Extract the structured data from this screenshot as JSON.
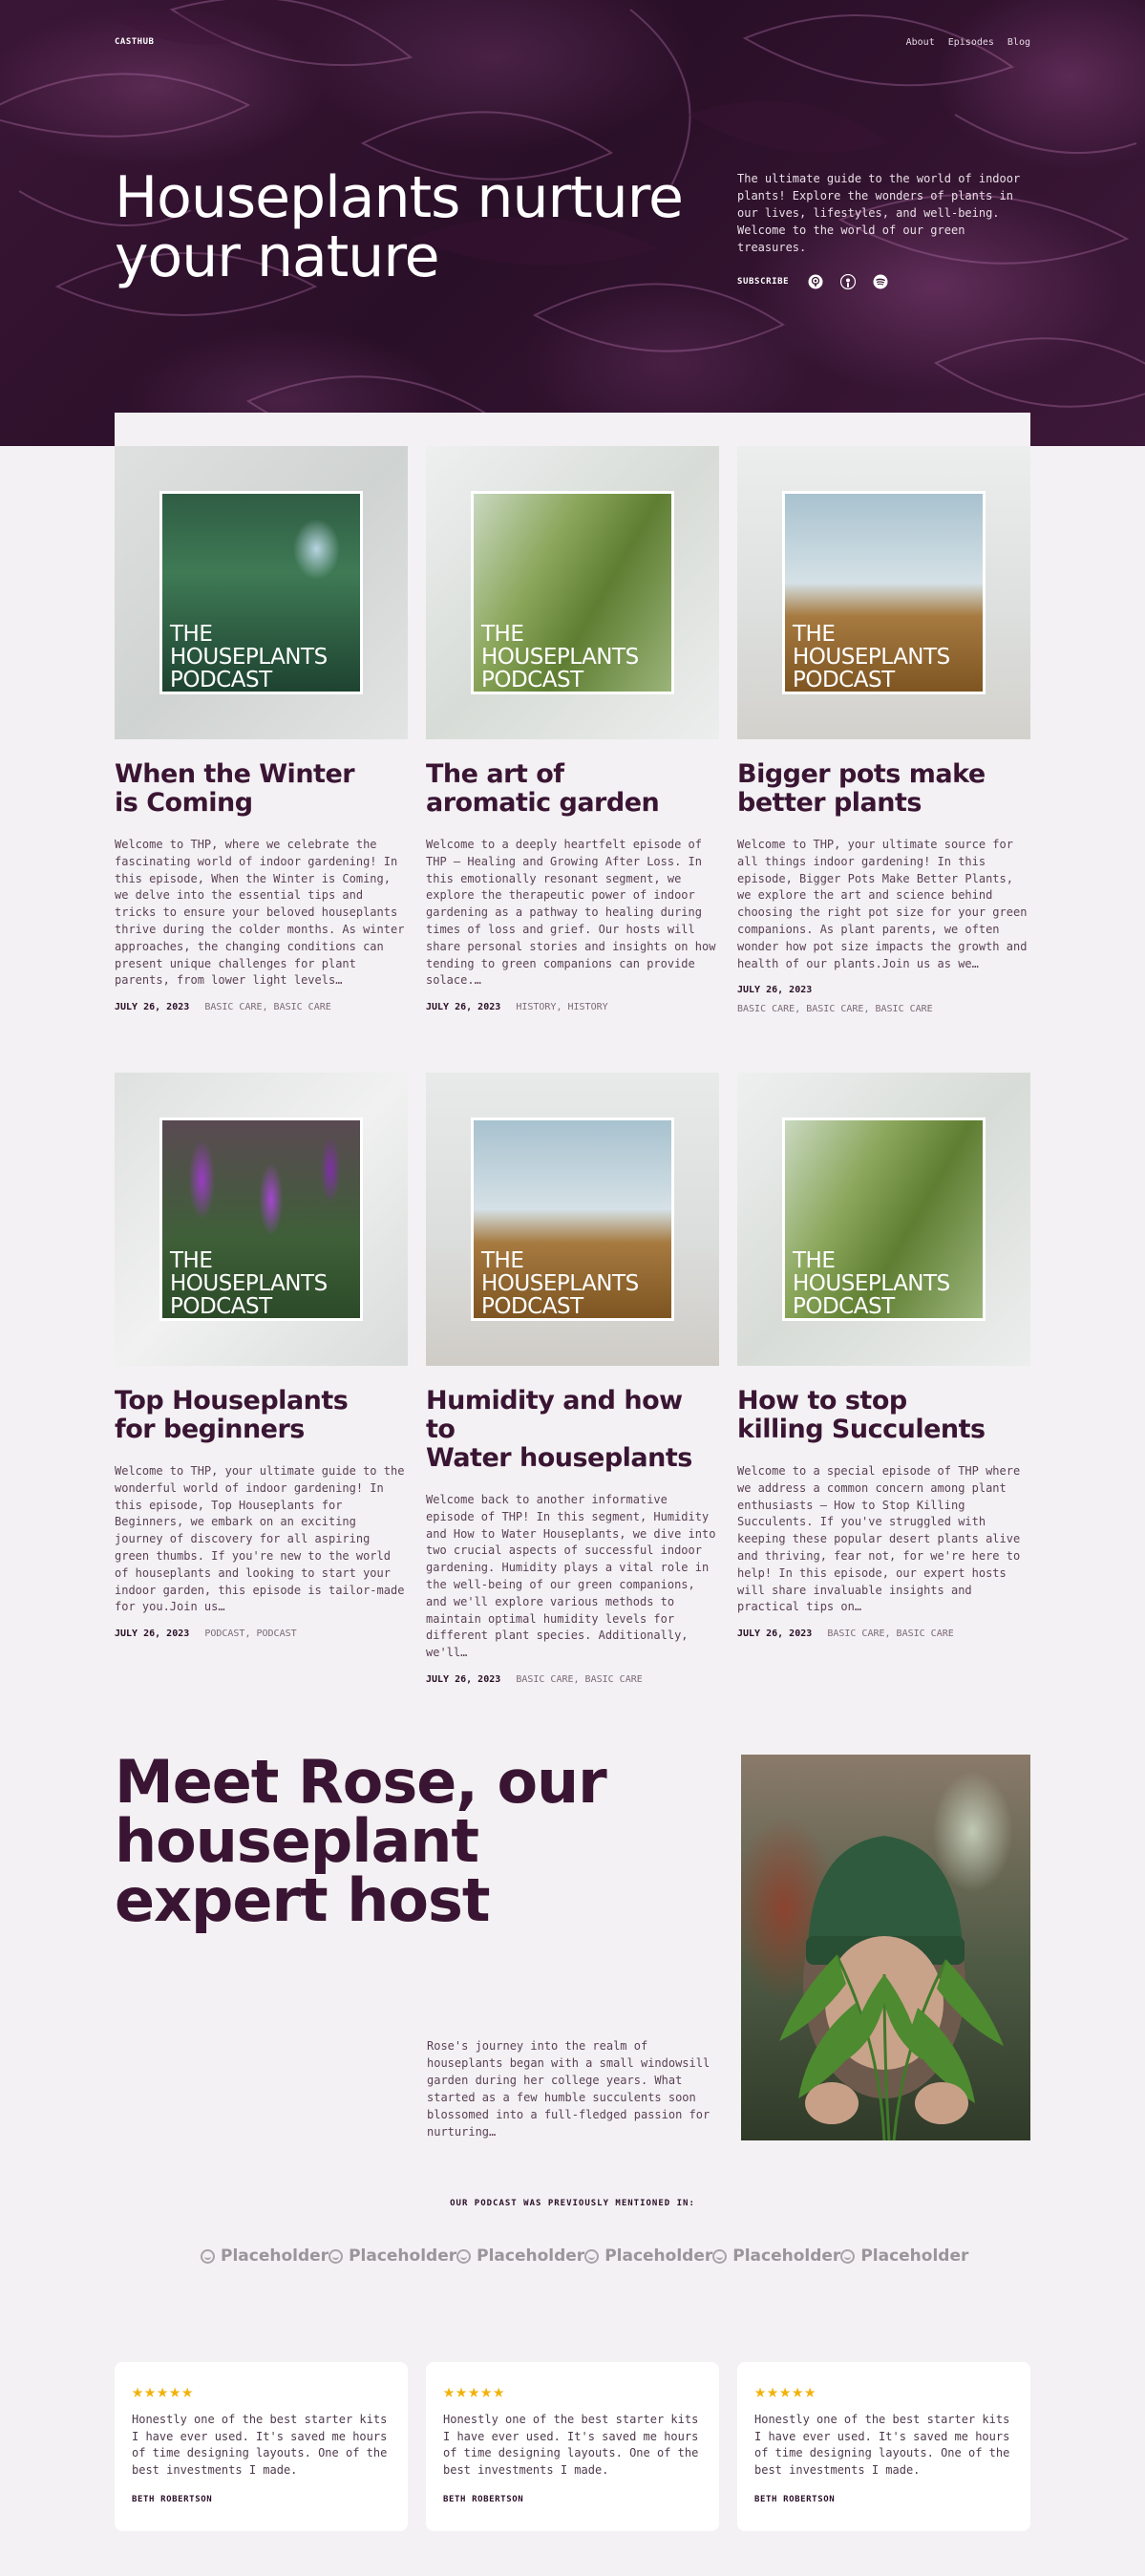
{
  "header": {
    "brand": "CASTHUB",
    "nav": [
      "About",
      "Episodes",
      "Blog"
    ]
  },
  "hero": {
    "title": "Houseplants nurture your nature",
    "description": "The ultimate guide to the world of indoor plants! Explore the wonders of plants in our lives, lifestyles, and well-being. Welcome to the world of our green treasures.",
    "subscribe_label": "SUBSCRIBE",
    "subscribe_icons": [
      "apple-podcasts-icon",
      "podcast-icon",
      "spotify-icon"
    ]
  },
  "cover_text": "THE\nHOUSEPLANTS\nPODCAST",
  "episodes": [
    {
      "title": "When the Winter\nis Coming",
      "description": "Welcome to THP, where we celebrate the fascinating world of indoor gardening! In this episode, When the Winter is Coming, we delve into the essential tips and tricks to ensure your beloved houseplants thrive during the colder months. As winter approaches, the changing conditions can present unique challenges for plant parents, from lower light levels…",
      "date": "JULY 26, 2023",
      "tags": "BASIC CARE, BASIC CARE"
    },
    {
      "title": "The art of\naromatic garden",
      "description": "Welcome to a deeply heartfelt episode of THP – Healing and Growing After Loss. In this emotionally resonant segment, we explore the therapeutic power of indoor gardening as a pathway to healing during times of loss and grief. Our hosts will share personal stories and insights on how tending to green companions can provide solace.…",
      "date": "JULY 26, 2023",
      "tags": "HISTORY, HISTORY"
    },
    {
      "title": "Bigger pots make\nbetter plants",
      "description": "Welcome to THP, your ultimate source for all things indoor gardening! In this episode, Bigger Pots Make Better Plants, we explore the art and science behind choosing the right pot size for your green companions. As plant parents, we often wonder how pot size impacts the growth and health of our plants.Join us as we…",
      "date": "JULY 26, 2023",
      "tags": "BASIC CARE, BASIC CARE, BASIC CARE"
    },
    {
      "title": "Top Houseplants\nfor beginners",
      "description": "Welcome to THP, your ultimate guide to the wonderful world of indoor gardening! In this episode, Top Houseplants for Beginners, we embark on an exciting journey of discovery for all aspiring green thumbs. If you're new to the world of houseplants and looking to start your indoor garden, this episode is tailor-made for you.Join us…",
      "date": "JULY 26, 2023",
      "tags": "PODCAST, PODCAST"
    },
    {
      "title": "Humidity and how to\nWater houseplants",
      "description": "Welcome back to another informative episode of THP! In this segment, Humidity and How to Water Houseplants, we dive into two crucial aspects of successful indoor gardening. Humidity plays a vital role in the well-being of our green companions, and we'll explore various methods to maintain optimal humidity levels for different plant species. Additionally, we'll…",
      "date": "JULY 26, 2023",
      "tags": "BASIC CARE, BASIC CARE"
    },
    {
      "title": "How to stop\nkilling Succulents",
      "description": "Welcome to a special episode of THP where we address a common concern among plant enthusiasts – How to Stop Killing Succulents. If you've struggled with keeping these popular desert plants alive and thriving, fear not, for we're here to help! In this episode, our expert hosts will share invaluable insights and practical tips on…",
      "date": "JULY 26, 2023",
      "tags": "BASIC CARE, BASIC CARE"
    }
  ],
  "host": {
    "title": "Meet Rose, our houseplant expert host",
    "text": "Rose's journey into the realm of houseplants began with a small windowsill garden during her college years. What started as a few humble succulents soon blossomed into a full-fledged passion for nurturing…"
  },
  "mentions": {
    "label": "OUR PODCAST WAS PREVIOUSLY MENTIONED IN:",
    "logos": [
      "Placeholder",
      "Placeholder",
      "Placeholder",
      "Placeholder",
      "Placeholder",
      "Placeholder"
    ]
  },
  "testimonials": [
    {
      "rating": 5,
      "stars": "★★★★★",
      "quote": "Honestly one of the best starter kits I have ever used. It's saved me hours of time designing layouts. One of the best investments I made.",
      "name": "BETH ROBERTSON"
    },
    {
      "rating": 5,
      "stars": "★★★★★",
      "quote": "Honestly one of the best starter kits I have ever used. It's saved me hours of time designing layouts. One of the best investments I made.",
      "name": "BETH ROBERTSON"
    },
    {
      "rating": 5,
      "stars": "★★★★★",
      "quote": "Honestly one of the best starter kits I have ever used. It's saved me hours of time designing layouts. One of the best investments I made.",
      "name": "BETH ROBERTSON"
    }
  ]
}
